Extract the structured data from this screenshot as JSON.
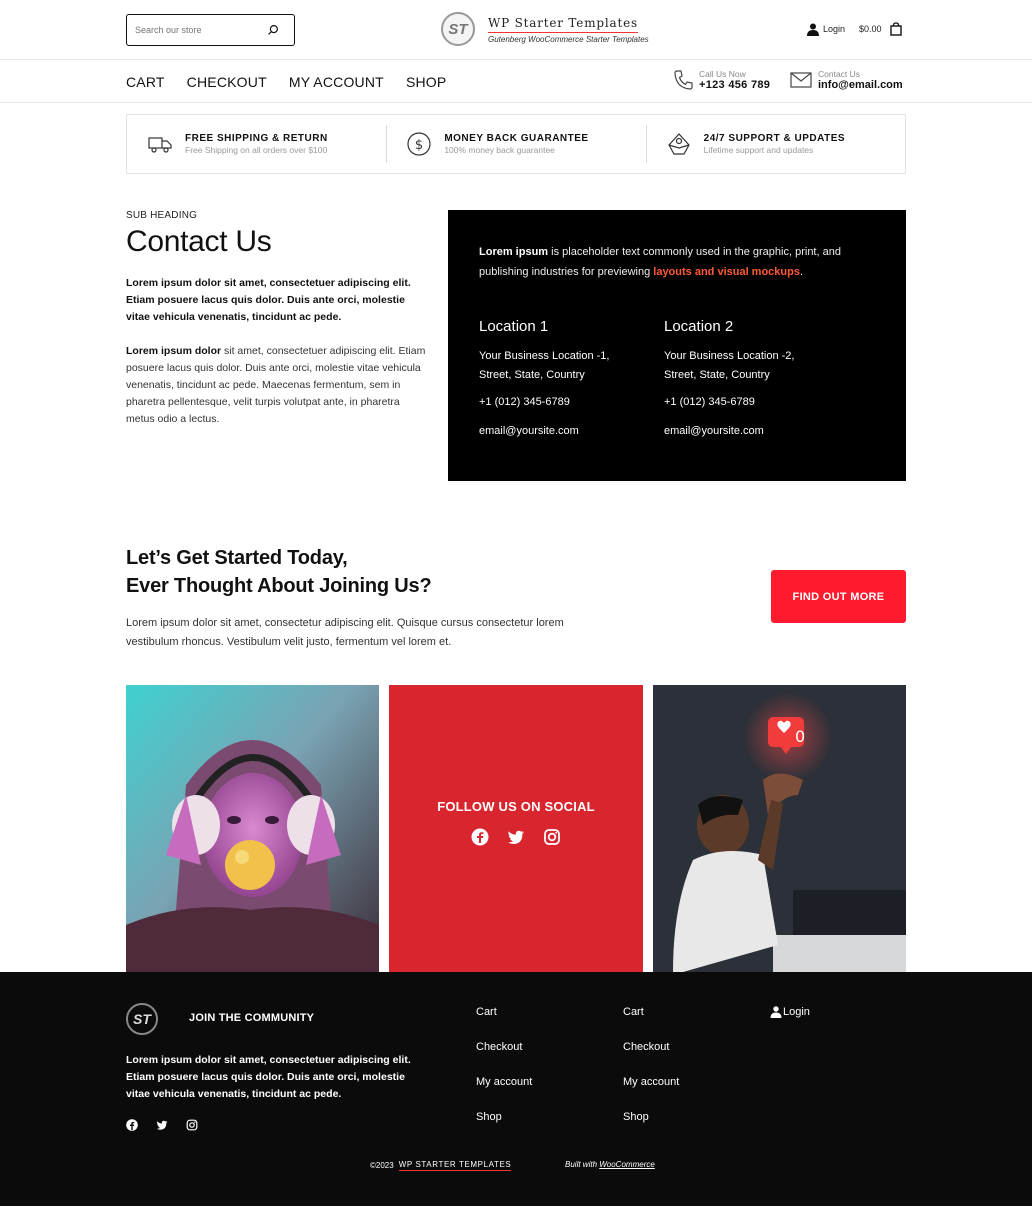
{
  "header": {
    "search_placeholder": "Search our store",
    "logo_mark": "ST",
    "site_title": "WP Starter Templates",
    "site_tagline": "Gutenberg WooCommerce Starter Templates",
    "login_label": "Login",
    "cart_total": "$0.00"
  },
  "nav": {
    "items": [
      "CART",
      "CHECKOUT",
      "MY ACCOUNT",
      "SHOP"
    ],
    "call_label": "Call Us Now",
    "call_value": "+123 456 789",
    "mail_label": "Contact Us",
    "mail_value": "info@email.com"
  },
  "features": [
    {
      "title": "FREE SHIPPING & RETURN",
      "subtitle": "Free Shipping on all orders over $100",
      "icon": "truck-icon"
    },
    {
      "title": "MONEY BACK GUARANTEE",
      "subtitle": "100% money back guarantee",
      "icon": "dollar-coin-icon"
    },
    {
      "title": "24/7 SUPPORT & UPDATES",
      "subtitle": "Lifetime support and updates",
      "icon": "support-icon"
    }
  ],
  "contact": {
    "subheading": "SUB HEADING",
    "title": "Contact Us",
    "para1": "Lorem ipsum dolor sit amet, consectetuer adipiscing elit. Etiam posuere lacus quis dolor. Duis ante orci, molestie vitae vehicula venenatis, tincidunt ac pede.",
    "para2_bold": "Lorem ipsum dolor",
    "para2_rest": " sit amet, consectetuer adipiscing elit. Etiam posuere lacus quis dolor. Duis ante orci, molestie vitae vehicula venenatis, tincidunt ac pede. Maecenas fermentum, sem in pharetra pellentesque, velit turpis volutpat ante, in pharetra metus odio a lectus.",
    "intro_bold": "Lorem ipsum",
    "intro_text": " is placeholder text commonly used in the graphic, print, and publishing industries for previewing ",
    "intro_highlight": "layouts and visual mockups",
    "intro_end": ".",
    "locations": [
      {
        "title": "Location 1",
        "address1": "Your Business Location -1,",
        "address2": "Street, State, Country",
        "phone": "+1 (012) 345-6789",
        "email": "email@yoursite.com"
      },
      {
        "title": "Location 2",
        "address1": "Your Business Location -2,",
        "address2": "Street, State, Country",
        "phone": "+1 (012) 345-6789",
        "email": "email@yoursite.com"
      }
    ]
  },
  "cta": {
    "title_line1": "Let’s Get Started Today,",
    "title_line2": "Ever Thought About Joining Us?",
    "text": "Lorem ipsum dolor sit amet, consectetur adipiscing elit. Quisque cursus consectetur lorem vestibulum rhoncus. Vestibulum velit justo, fermentum vel lorem et.",
    "button": "FIND OUT MORE"
  },
  "social_block": {
    "title": "FOLLOW US ON SOCIAL",
    "like_count": "0"
  },
  "footer": {
    "logo_mark": "ST",
    "join": "JOIN THE COMMUNITY",
    "text": "Lorem ipsum dolor sit amet, consectetuer adipiscing elit. Etiam posuere lacus quis dolor. Duis ante orci, molestie vitae vehicula venenatis, tincidunt ac pede.",
    "col1": [
      "Cart",
      "Checkout",
      "My account",
      "Shop"
    ],
    "col2": [
      "Cart",
      "Checkout",
      "My account",
      "Shop"
    ],
    "login": "Login",
    "copyright": "©2023",
    "brand": "WP STARTER TEMPLATES",
    "built_prefix": "Built with ",
    "built_link": "WooCommerce"
  },
  "colors": {
    "accent_red": "#ff1a2e",
    "social_red": "#d9262e",
    "highlight_orange": "#ff5a36",
    "footer_bg": "#0b0b0b"
  }
}
